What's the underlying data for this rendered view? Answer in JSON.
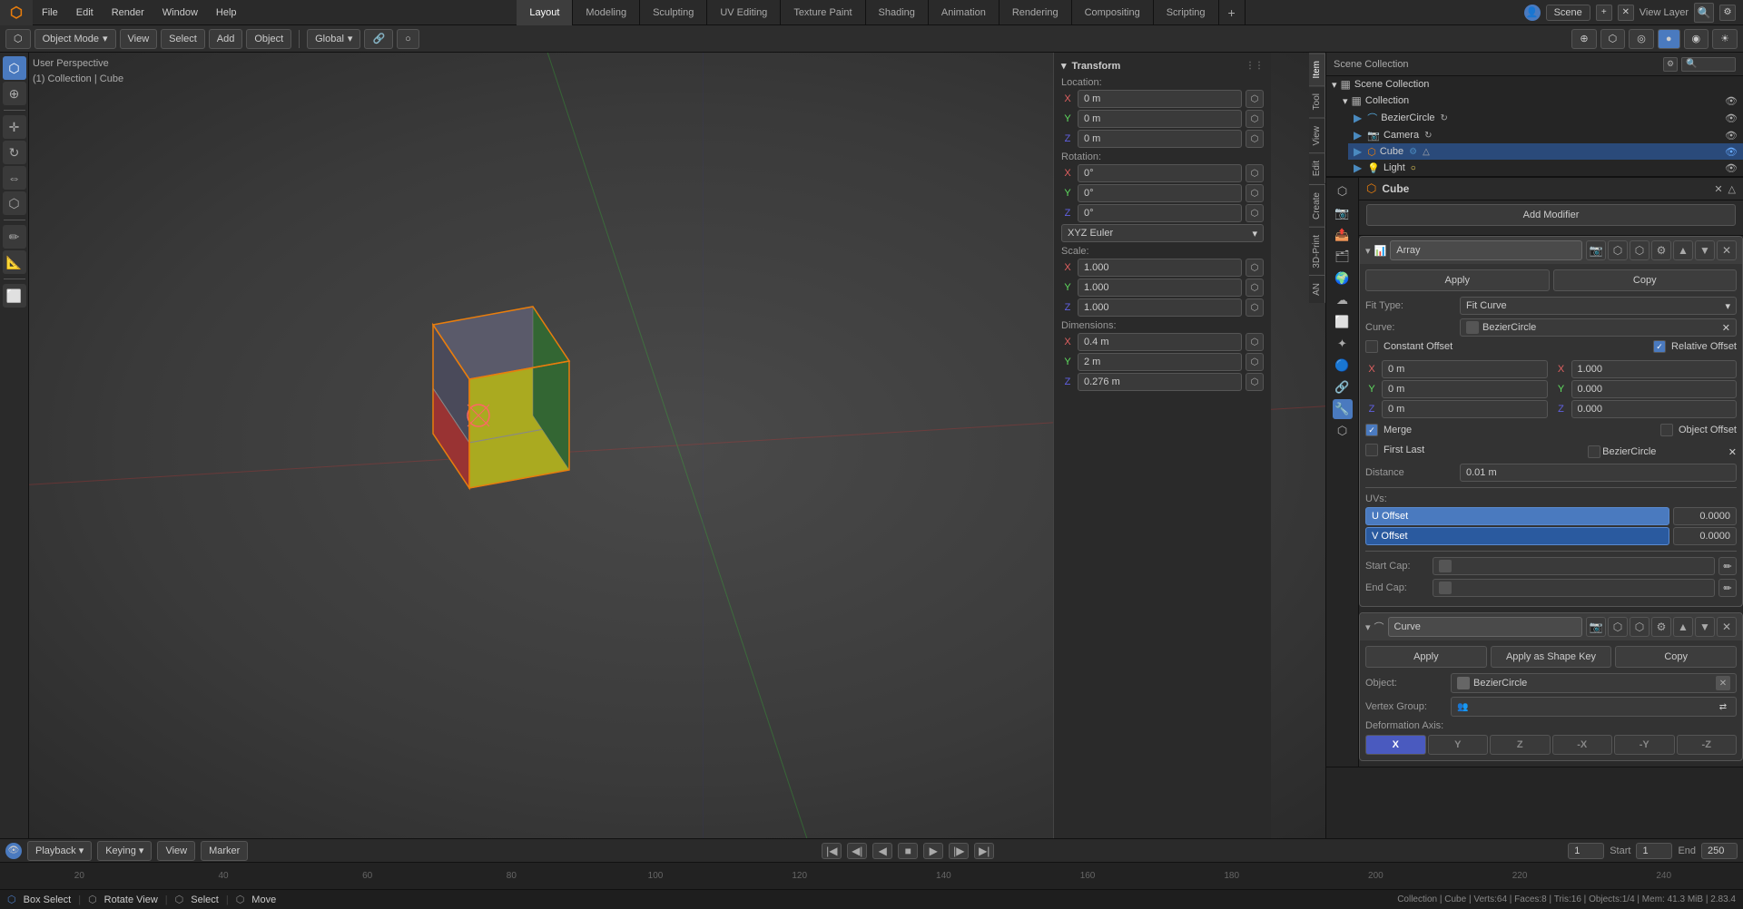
{
  "app": {
    "logo": "🔵",
    "menus": [
      "File",
      "Edit",
      "Render",
      "Window",
      "Help"
    ]
  },
  "workspaces": [
    {
      "label": "Layout",
      "active": true
    },
    {
      "label": "Modeling"
    },
    {
      "label": "Sculpting"
    },
    {
      "label": "UV Editing"
    },
    {
      "label": "Texture Paint"
    },
    {
      "label": "Shading"
    },
    {
      "label": "Animation"
    },
    {
      "label": "Rendering"
    },
    {
      "label": "Compositing"
    },
    {
      "label": "Scripting"
    }
  ],
  "scene": {
    "name": "Scene"
  },
  "view_layer": {
    "name": "View Layer"
  },
  "header": {
    "mode": "Object Mode",
    "view": "View",
    "select": "Select",
    "add": "Add",
    "object": "Object",
    "transform": "Global"
  },
  "viewport": {
    "title": "User Perspective",
    "collection": "(1) Collection | Cube"
  },
  "n_panel_tabs": [
    "Item",
    "Tool",
    "View",
    "Edit",
    "Create",
    "3D-Print",
    "AN"
  ],
  "transform": {
    "title": "Transform",
    "location": {
      "label": "Location:",
      "x": "0 m",
      "y": "0 m",
      "z": "0 m"
    },
    "rotation": {
      "label": "Rotation:",
      "x": "0°",
      "y": "0°",
      "z": "0°",
      "mode": "XYZ Euler"
    },
    "scale": {
      "label": "Scale:",
      "x": "1.000",
      "y": "1.000",
      "z": "1.000"
    },
    "dimensions": {
      "label": "Dimensions:",
      "x": "0.4 m",
      "y": "2 m",
      "z": "0.276 m"
    }
  },
  "outliner": {
    "title": "Scene Collection",
    "items": [
      {
        "name": "Collection",
        "type": "collection",
        "indent": 0
      },
      {
        "name": "BezierCircle",
        "type": "curve",
        "indent": 1
      },
      {
        "name": "Camera",
        "type": "camera",
        "indent": 1
      },
      {
        "name": "Cube",
        "type": "mesh",
        "indent": 1,
        "active": true
      },
      {
        "name": "Light",
        "type": "light",
        "indent": 1
      }
    ]
  },
  "properties": {
    "active_object": "Cube",
    "icon_tabs": [
      "scene",
      "render",
      "output",
      "view_layer",
      "scene2",
      "world",
      "object",
      "mesh",
      "particles",
      "physics",
      "constraints",
      "modifier",
      "data"
    ],
    "active_tab": "modifier"
  },
  "modifiers": {
    "title": "Add Modifier",
    "array_mod": {
      "name": "Array",
      "apply_btn": "Apply",
      "copy_btn": "Copy",
      "fit_type_label": "Fit Type:",
      "fit_type_val": "Fit Curve",
      "curve_label": "Curve:",
      "curve_val": "BezierCircle",
      "constant_offset_label": "Constant Offset",
      "relative_offset_label": "Relative Offset",
      "rel_x": "1.000",
      "rel_y": "0.000",
      "rel_z": "0.000",
      "const_x": "0 m",
      "const_y": "0 m",
      "const_z": "0 m",
      "merge_label": "Merge",
      "object_offset_label": "Object Offset",
      "first_last_label": "First Last",
      "beziercircle_label": "BezierCircle",
      "distance_label": "Distance",
      "distance_val": "0.01 m",
      "uvs_label": "UVs:",
      "u_offset_label": "U Offset",
      "u_offset_val": "0.0000",
      "v_offset_label": "V Offset",
      "v_offset_val": "0.0000",
      "start_cap_label": "Start Cap:",
      "end_cap_label": "End Cap:"
    },
    "curve_mod": {
      "name": "Curve",
      "apply_btn": "Apply",
      "apply_shape_key_btn": "Apply as Shape Key",
      "copy_btn": "Copy",
      "object_label": "Object:",
      "object_val": "BezierCircle",
      "vertex_group_label": "Vertex Group:",
      "vertex_group_val": "",
      "deformation_axis_label": "Deformation Axis:",
      "axes": [
        "X",
        "Y",
        "Z",
        "-X",
        "-Y",
        "-Z"
      ],
      "active_axis": "X"
    }
  },
  "timeline": {
    "start": "1",
    "current": "1",
    "end": "250",
    "start_label": "Start",
    "end_label": "End",
    "frame_markers": [
      "20",
      "40",
      "60",
      "80",
      "100",
      "120",
      "140",
      "160",
      "180",
      "200",
      "220",
      "240"
    ]
  },
  "status_bar": {
    "text": "Collection | Cube | Verts:64 | Faces:8 | Tris:16 | Objects:1/4 | Mem: 41.3 MiB | 2.83.4",
    "left_tool": "Box Select",
    "middle_tool": "Rotate View",
    "right_tool": "Select",
    "right_tool2": "Move"
  }
}
